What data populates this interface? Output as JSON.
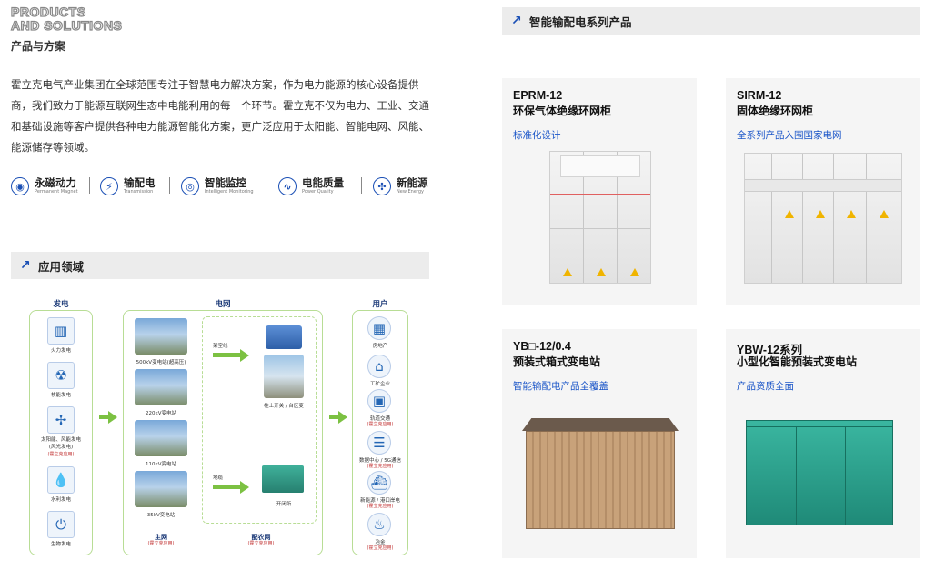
{
  "header": {
    "title_en_1": "PRODUCTS",
    "title_en_2": "AND SOLUTIONS",
    "title_cn": "产品与方案"
  },
  "intro": "霍立克电气产业集团在全球范围专注于智慧电力解决方案，作为电力能源的核心设备提供商，我们致力于能源互联网生态中电能利用的每一个环节。霍立克不仅为电力、工业、交通和基础设施等客户提供各种电力能源智能化方案，更广泛应用于太阳能、智能电网、风能、能源储存等领域。",
  "features": [
    {
      "cn": "永磁动力",
      "en": "Permanent Magnet",
      "icon": "magnet-icon"
    },
    {
      "cn": "输配电",
      "en": "Transmission",
      "icon": "power-transmission-icon"
    },
    {
      "cn": "智能监控",
      "en": "Intelligent Monitoring",
      "icon": "monitor-icon"
    },
    {
      "cn": "电能质量",
      "en": "Power Quality",
      "icon": "power-quality-icon"
    },
    {
      "cn": "新能源",
      "en": "New Energy",
      "icon": "wind-energy-icon"
    }
  ],
  "application": {
    "section_title": "应用领域",
    "generation": {
      "title": "发电",
      "items": [
        {
          "label": "火力发电",
          "note": ""
        },
        {
          "label": "核能发电",
          "note": ""
        },
        {
          "label": "太阳能、风能发电",
          "label2": "(风光发电)",
          "note": "(霍立克应用)"
        },
        {
          "label": "水利发电",
          "note": ""
        },
        {
          "label": "生物发电",
          "note": ""
        }
      ]
    },
    "grid": {
      "title": "电网",
      "main_grid": {
        "items": [
          "500kV变电站(超高压)",
          "220kV变电站",
          "110kV变电站",
          "35kV变电站"
        ],
        "label": "主网",
        "note": "(霍立克应用)"
      },
      "distribution": {
        "overhead_label": "架空线",
        "overhead_item": "柱上开关 / 台区变",
        "cable_label": "地缆",
        "cable_item": "开闭所",
        "label": "配农网",
        "note": "(霍立克应用)"
      }
    },
    "users": {
      "title": "用户",
      "items": [
        {
          "label": "房地产",
          "note": ""
        },
        {
          "label": "工矿企业",
          "note": ""
        },
        {
          "label": "轨道交通",
          "note": "(霍立克应用)"
        },
        {
          "label": "数据中心 / 5G通信",
          "note": "(霍立克应用)"
        },
        {
          "label": "新能源 / 港口岸电",
          "note": "(霍立克应用)"
        },
        {
          "label": "冶金",
          "note": "(霍立克应用)"
        }
      ]
    }
  },
  "products": {
    "section_title": "智能输配电系列产品",
    "cards": [
      {
        "model": "EPRM-12",
        "name": "环保气体绝缘环网柜",
        "tag": "标准化设计"
      },
      {
        "model": "SIRM-12",
        "name": "固体绝缘环网柜",
        "tag": "全系列产品入围国家电网"
      },
      {
        "model": "YB□-12/0.4",
        "name": "预装式箱式变电站",
        "tag": "智能输配电产品全覆盖"
      },
      {
        "model": "YBW-12系列",
        "name": "小型化智能预装式变电站",
        "tag": "产品资质全面"
      }
    ]
  },
  "colors": {
    "accent": "#1a55c8",
    "green": "#7cc142",
    "section_bg": "#ececec",
    "card_bg": "#f5f5f5"
  }
}
